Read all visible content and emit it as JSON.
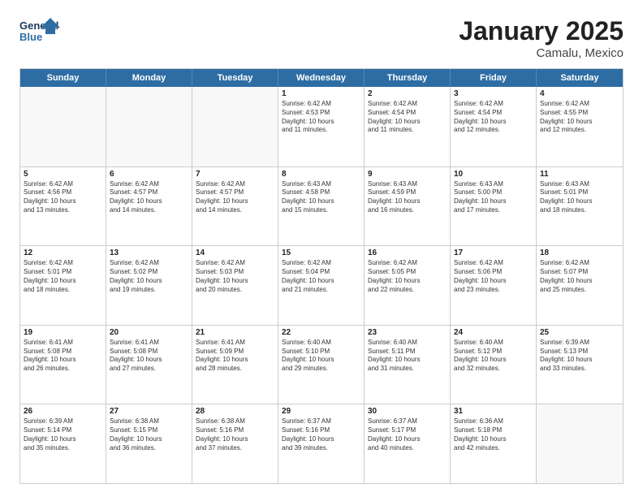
{
  "header": {
    "logo_line1": "General",
    "logo_line2": "Blue",
    "month_year": "January 2025",
    "location": "Camalu, Mexico"
  },
  "weekdays": [
    "Sunday",
    "Monday",
    "Tuesday",
    "Wednesday",
    "Thursday",
    "Friday",
    "Saturday"
  ],
  "rows": [
    [
      {
        "day": "",
        "text": ""
      },
      {
        "day": "",
        "text": ""
      },
      {
        "day": "",
        "text": ""
      },
      {
        "day": "1",
        "text": "Sunrise: 6:42 AM\nSunset: 4:53 PM\nDaylight: 10 hours\nand 11 minutes."
      },
      {
        "day": "2",
        "text": "Sunrise: 6:42 AM\nSunset: 4:54 PM\nDaylight: 10 hours\nand 11 minutes."
      },
      {
        "day": "3",
        "text": "Sunrise: 6:42 AM\nSunset: 4:54 PM\nDaylight: 10 hours\nand 12 minutes."
      },
      {
        "day": "4",
        "text": "Sunrise: 6:42 AM\nSunset: 4:55 PM\nDaylight: 10 hours\nand 12 minutes."
      }
    ],
    [
      {
        "day": "5",
        "text": "Sunrise: 6:42 AM\nSunset: 4:56 PM\nDaylight: 10 hours\nand 13 minutes."
      },
      {
        "day": "6",
        "text": "Sunrise: 6:42 AM\nSunset: 4:57 PM\nDaylight: 10 hours\nand 14 minutes."
      },
      {
        "day": "7",
        "text": "Sunrise: 6:42 AM\nSunset: 4:57 PM\nDaylight: 10 hours\nand 14 minutes."
      },
      {
        "day": "8",
        "text": "Sunrise: 6:43 AM\nSunset: 4:58 PM\nDaylight: 10 hours\nand 15 minutes."
      },
      {
        "day": "9",
        "text": "Sunrise: 6:43 AM\nSunset: 4:59 PM\nDaylight: 10 hours\nand 16 minutes."
      },
      {
        "day": "10",
        "text": "Sunrise: 6:43 AM\nSunset: 5:00 PM\nDaylight: 10 hours\nand 17 minutes."
      },
      {
        "day": "11",
        "text": "Sunrise: 6:43 AM\nSunset: 5:01 PM\nDaylight: 10 hours\nand 18 minutes."
      }
    ],
    [
      {
        "day": "12",
        "text": "Sunrise: 6:42 AM\nSunset: 5:01 PM\nDaylight: 10 hours\nand 18 minutes."
      },
      {
        "day": "13",
        "text": "Sunrise: 6:42 AM\nSunset: 5:02 PM\nDaylight: 10 hours\nand 19 minutes."
      },
      {
        "day": "14",
        "text": "Sunrise: 6:42 AM\nSunset: 5:03 PM\nDaylight: 10 hours\nand 20 minutes."
      },
      {
        "day": "15",
        "text": "Sunrise: 6:42 AM\nSunset: 5:04 PM\nDaylight: 10 hours\nand 21 minutes."
      },
      {
        "day": "16",
        "text": "Sunrise: 6:42 AM\nSunset: 5:05 PM\nDaylight: 10 hours\nand 22 minutes."
      },
      {
        "day": "17",
        "text": "Sunrise: 6:42 AM\nSunset: 5:06 PM\nDaylight: 10 hours\nand 23 minutes."
      },
      {
        "day": "18",
        "text": "Sunrise: 6:42 AM\nSunset: 5:07 PM\nDaylight: 10 hours\nand 25 minutes."
      }
    ],
    [
      {
        "day": "19",
        "text": "Sunrise: 6:41 AM\nSunset: 5:08 PM\nDaylight: 10 hours\nand 26 minutes."
      },
      {
        "day": "20",
        "text": "Sunrise: 6:41 AM\nSunset: 5:08 PM\nDaylight: 10 hours\nand 27 minutes."
      },
      {
        "day": "21",
        "text": "Sunrise: 6:41 AM\nSunset: 5:09 PM\nDaylight: 10 hours\nand 28 minutes."
      },
      {
        "day": "22",
        "text": "Sunrise: 6:40 AM\nSunset: 5:10 PM\nDaylight: 10 hours\nand 29 minutes."
      },
      {
        "day": "23",
        "text": "Sunrise: 6:40 AM\nSunset: 5:11 PM\nDaylight: 10 hours\nand 31 minutes."
      },
      {
        "day": "24",
        "text": "Sunrise: 6:40 AM\nSunset: 5:12 PM\nDaylight: 10 hours\nand 32 minutes."
      },
      {
        "day": "25",
        "text": "Sunrise: 6:39 AM\nSunset: 5:13 PM\nDaylight: 10 hours\nand 33 minutes."
      }
    ],
    [
      {
        "day": "26",
        "text": "Sunrise: 6:39 AM\nSunset: 5:14 PM\nDaylight: 10 hours\nand 35 minutes."
      },
      {
        "day": "27",
        "text": "Sunrise: 6:38 AM\nSunset: 5:15 PM\nDaylight: 10 hours\nand 36 minutes."
      },
      {
        "day": "28",
        "text": "Sunrise: 6:38 AM\nSunset: 5:16 PM\nDaylight: 10 hours\nand 37 minutes."
      },
      {
        "day": "29",
        "text": "Sunrise: 6:37 AM\nSunset: 5:16 PM\nDaylight: 10 hours\nand 39 minutes."
      },
      {
        "day": "30",
        "text": "Sunrise: 6:37 AM\nSunset: 5:17 PM\nDaylight: 10 hours\nand 40 minutes."
      },
      {
        "day": "31",
        "text": "Sunrise: 6:36 AM\nSunset: 5:18 PM\nDaylight: 10 hours\nand 42 minutes."
      },
      {
        "day": "",
        "text": ""
      }
    ]
  ]
}
